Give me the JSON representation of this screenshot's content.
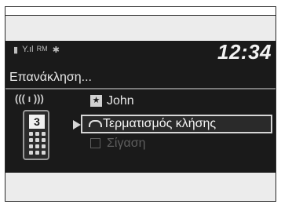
{
  "screen": {
    "status": {
      "battery_icon": "battery-icon",
      "signal_icon": "signal-bars-icon",
      "roaming_label": "RM",
      "bluetooth_icon": "bluetooth-icon",
      "clock": "12:34"
    },
    "title": "Επανάκληση...",
    "signal_indicator": "((( ı )))",
    "phone_number": "3",
    "menu": {
      "items": [
        {
          "label": "John",
          "icon": "star-icon"
        },
        {
          "label": "Τερματισμός κλήσης",
          "icon": "handset-icon",
          "selected": true
        },
        {
          "label": "Σίγαση",
          "icon": "checkbox-icon",
          "disabled": true
        }
      ]
    }
  }
}
